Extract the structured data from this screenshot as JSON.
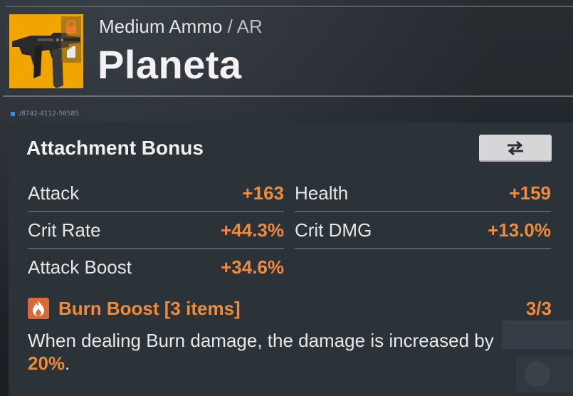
{
  "header": {
    "category": "Medium Ammo",
    "separator": "/",
    "weapon_type": "AR",
    "name": "Planeta",
    "serial": "/8742-4112-58585",
    "thumbnail_bg": "#f0a500",
    "icons": [
      "lock-icon",
      "equipped-icon",
      "assault-rifle-icon"
    ]
  },
  "attachment": {
    "title": "Attachment Bonus",
    "swap_icon": "swap-arrows-icon",
    "stats": [
      {
        "label": "Attack",
        "value": "+163"
      },
      {
        "label": "Health",
        "value": "+159"
      },
      {
        "label": "Crit Rate",
        "value": "+44.3%"
      },
      {
        "label": "Crit DMG",
        "value": "+13.0%"
      },
      {
        "label": "Attack Boost",
        "value": "+34.6%"
      }
    ],
    "set": {
      "icon": "flame-icon",
      "name": "Burn Boost [3 items]",
      "count": "3/3",
      "description": "When dealing Burn damage, the damage is increased by",
      "highlight": "20%",
      "suffix": "."
    }
  },
  "colors": {
    "accent": "#f08a3c",
    "panel": "#2b3238",
    "background": "#1c2126",
    "serial_dot": "#2d8fe6"
  }
}
